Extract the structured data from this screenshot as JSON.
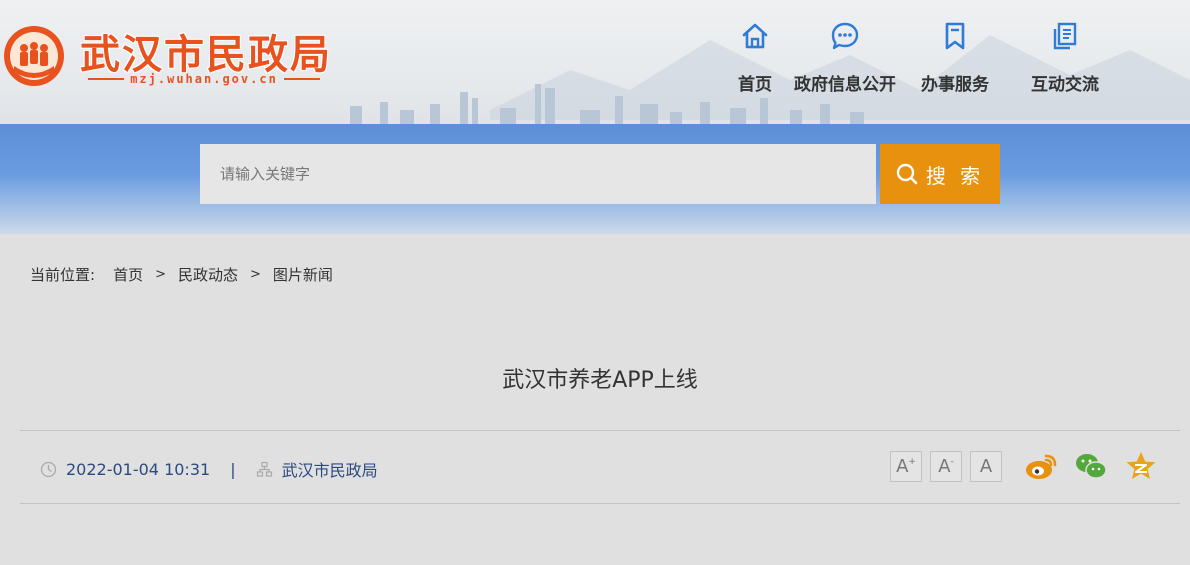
{
  "header": {
    "site_name": "武汉市民政局",
    "site_domain": "mzj.wuhan.gov.cn",
    "brand_color": "#e8521f"
  },
  "nav": [
    {
      "label": "首页",
      "icon": "home-icon"
    },
    {
      "label": "政府信息公开",
      "icon": "message-icon"
    },
    {
      "label": "办事服务",
      "icon": "bookmark-icon"
    },
    {
      "label": "互动交流",
      "icon": "documents-icon"
    }
  ],
  "search": {
    "placeholder": "请输入关键字",
    "button_label": "搜 索",
    "button_color": "#e8910f"
  },
  "breadcrumb": {
    "prefix": "当前位置:",
    "items": [
      "首页",
      "民政动态",
      "图片新闻"
    ],
    "separator": ">"
  },
  "article": {
    "title": "武汉市养老APP上线",
    "datetime": "2022-01-04 10:31",
    "meta_separator": "|",
    "source": "武汉市民政局"
  },
  "font_size_buttons": [
    {
      "label": "A",
      "modifier": "+"
    },
    {
      "label": "A",
      "modifier": "-"
    },
    {
      "label": "A",
      "modifier": ""
    }
  ],
  "share": [
    "weibo-icon",
    "wechat-icon",
    "qzone-icon"
  ]
}
